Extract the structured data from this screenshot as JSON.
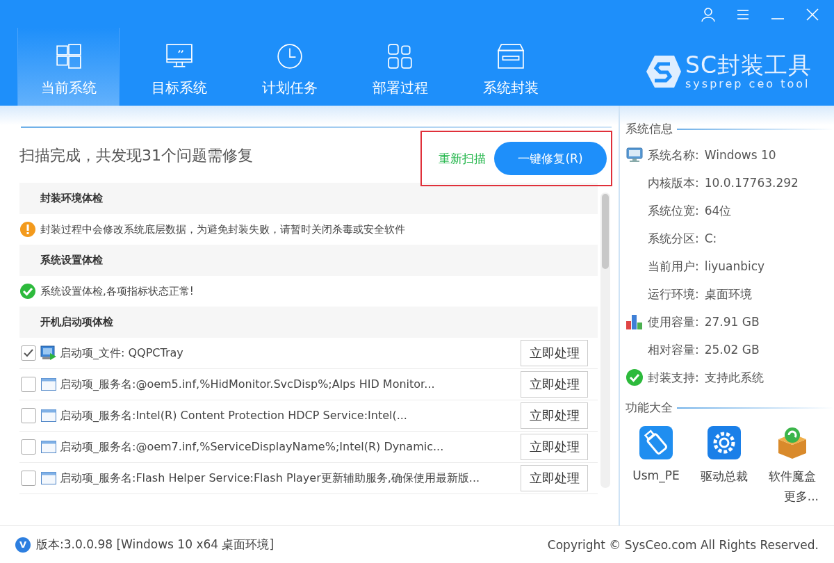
{
  "tabs": [
    {
      "label": "当前系统",
      "selected": true
    },
    {
      "label": "目标系统",
      "selected": false
    },
    {
      "label": "计划任务",
      "selected": false
    },
    {
      "label": "部署过程",
      "selected": false
    },
    {
      "label": "系统封装",
      "selected": false
    }
  ],
  "logo": {
    "title": "SC封装工具",
    "subtitle": "sysprep ceo tool"
  },
  "scan": {
    "summary": "扫描完成，共发现31个问题需修复",
    "rescan": "重新扫描",
    "fix": "一键修复(R)"
  },
  "sections": [
    {
      "title": "封装环境体检",
      "items": [
        {
          "kind": "warning",
          "text": "封装过程中会修改系统底层数据，为避免封装失败，请暂时关闭杀毒或安全软件"
        }
      ]
    },
    {
      "title": "系统设置体检",
      "items": [
        {
          "kind": "ok",
          "text": "系统设置体检,各项指标状态正常!"
        }
      ]
    },
    {
      "title": "开机启动项体检",
      "items": [
        {
          "kind": "file",
          "checked": true,
          "text": "启动项_文件: QQPCTray",
          "action": "立即处理"
        },
        {
          "kind": "service",
          "checked": false,
          "text": "启动项_服务名:@oem5.inf,%HidMonitor.SvcDisp%;Alps HID Monitor...",
          "action": "立即处理"
        },
        {
          "kind": "service",
          "checked": false,
          "text": "启动项_服务名:Intel(R) Content Protection HDCP Service:Intel(...",
          "action": "立即处理"
        },
        {
          "kind": "service",
          "checked": false,
          "text": "启动项_服务名:@oem7.inf,%ServiceDisplayName%;Intel(R) Dynamic...",
          "action": "立即处理"
        },
        {
          "kind": "service",
          "checked": false,
          "text": "启动项_服务名:Flash Helper Service:Flash Player更新辅助服务,确保使用最新版...",
          "action": "立即处理"
        }
      ]
    }
  ],
  "system_info": {
    "title": "系统信息",
    "rows": [
      {
        "kind": "system",
        "label": "系统名称:",
        "value": "Windows 10"
      },
      {
        "kind": "plain",
        "label": "内核版本:",
        "value": "10.0.17763.292"
      },
      {
        "kind": "plain",
        "label": "系统位宽:",
        "value": "64位"
      },
      {
        "kind": "plain",
        "label": "系统分区:",
        "value": "C:"
      },
      {
        "kind": "plain",
        "label": "当前用户:",
        "value": "liyuanbicy"
      },
      {
        "kind": "plain",
        "label": "运行环境:",
        "value": "桌面环境"
      },
      {
        "kind": "disk",
        "label": "使用容量:",
        "value": "27.91 GB"
      },
      {
        "kind": "plain",
        "label": "相对容量:",
        "value": "25.02 GB"
      },
      {
        "kind": "support",
        "label": "封装支持:",
        "value": "支持此系统"
      }
    ]
  },
  "tools": {
    "title": "功能大全",
    "items": [
      {
        "label": "Usm_PE"
      },
      {
        "label": "驱动总裁"
      },
      {
        "label": "软件魔盒"
      }
    ],
    "more": "更多..."
  },
  "footer": {
    "badge": "V",
    "version": "版本:3.0.0.98 [Windows 10 x64 桌面环境]",
    "copyright": "Copyright © SysCeo.com All Rights Reserved."
  }
}
